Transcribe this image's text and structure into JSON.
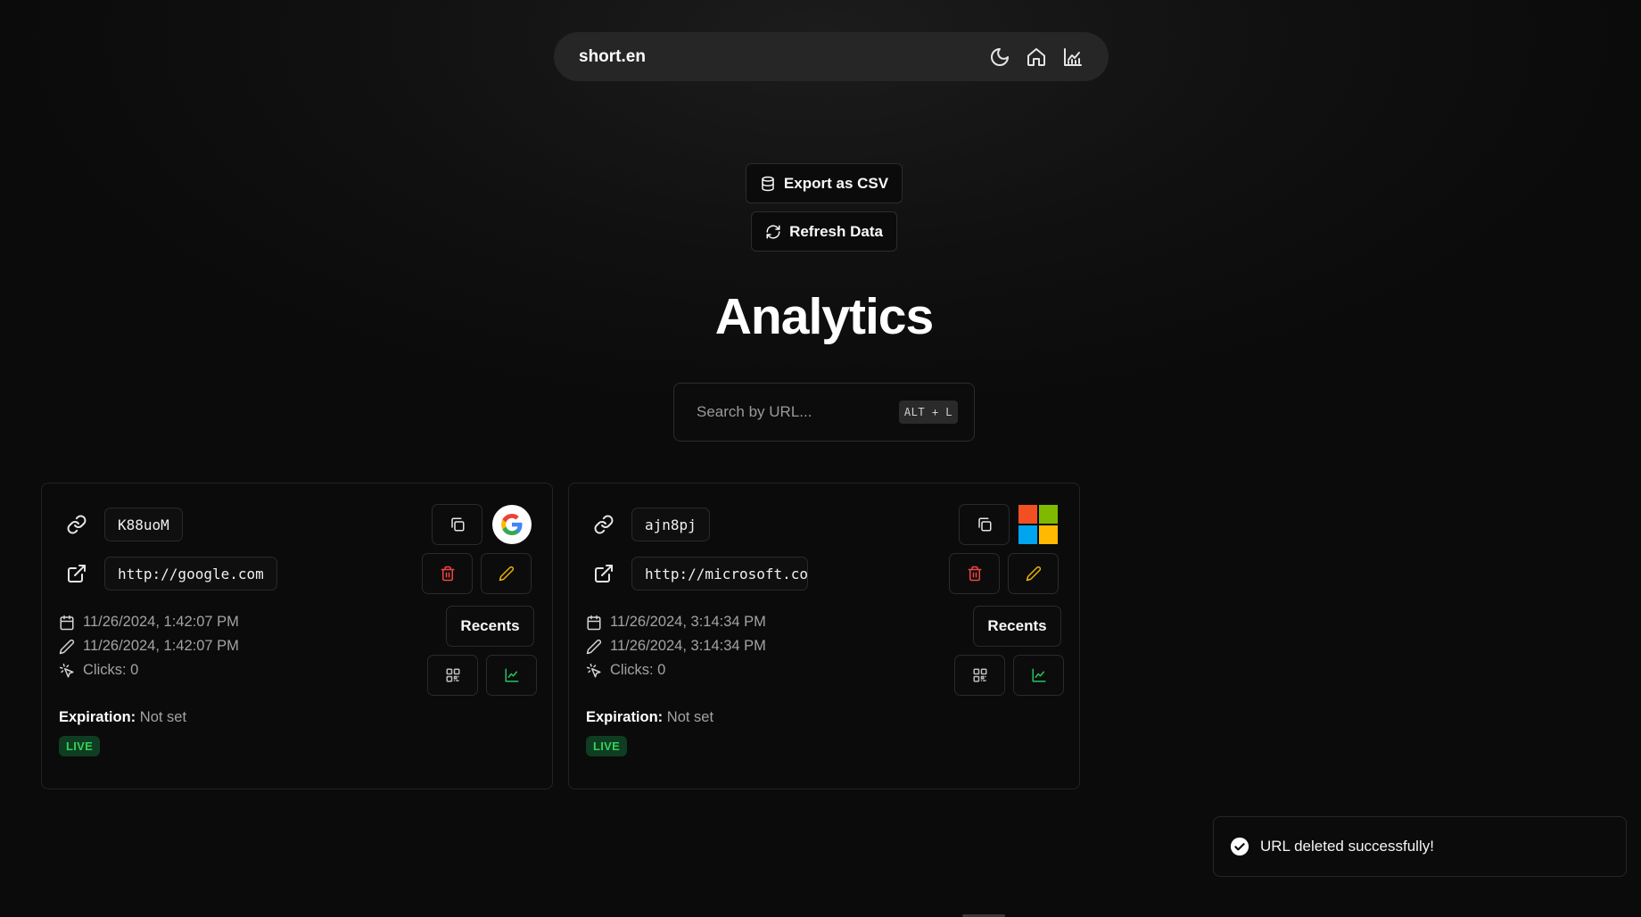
{
  "nav": {
    "brand": "short.en",
    "icons": [
      "moon-icon",
      "home-icon",
      "chart-icon"
    ]
  },
  "actions": {
    "export_label": "Export as CSV",
    "refresh_label": "Refresh Data"
  },
  "page_title": "Analytics",
  "search": {
    "placeholder": "Search by URL...",
    "value": "",
    "shortcut": "ALT + L"
  },
  "cards": [
    {
      "short_code": "K88uoM",
      "long_url": "http://google.com",
      "favicon": "google-logo",
      "created_at": "11/26/2024, 1:42:07 PM",
      "updated_at": "11/26/2024, 1:42:07 PM",
      "clicks": "Clicks: 0",
      "recents_label": "Recents",
      "expiration_label": "Expiration:",
      "expiration_value": "Not set",
      "status": "LIVE"
    },
    {
      "short_code": "ajn8pj",
      "long_url": "http://microsoft.co",
      "favicon": "microsoft-logo",
      "created_at": "11/26/2024, 3:14:34 PM",
      "updated_at": "11/26/2024, 3:14:34 PM",
      "clicks": "Clicks: 0",
      "recents_label": "Recents",
      "expiration_label": "Expiration:",
      "expiration_value": "Not set",
      "status": "LIVE"
    }
  ],
  "toast": {
    "message": "URL deleted successfully!"
  },
  "colors": {
    "background": "#111111",
    "nav_bg": "#262626",
    "delete_red": "#ef4444",
    "edit_yellow": "#eab308",
    "chart_green": "#22c55e",
    "live_green": "#34d058"
  }
}
